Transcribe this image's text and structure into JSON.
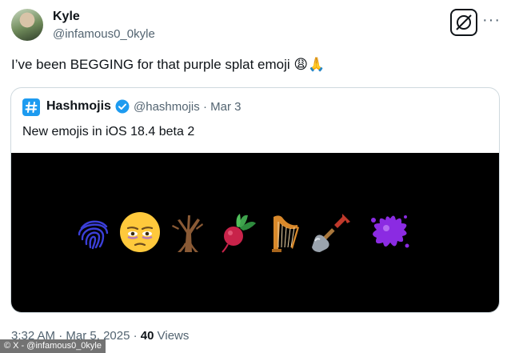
{
  "author": {
    "name": "Kyle",
    "handle": "@infamous0_0kyle"
  },
  "tweet": {
    "text": "I’ve been BEGGING for that purple splat emoji 😩🙏"
  },
  "quoted": {
    "name": "Hashmojis",
    "handle": "@hashmojis",
    "separator": "·",
    "date": "Mar 3",
    "text": "New emojis in iOS 18.4 beta 2",
    "emojis": [
      "fingerprint-icon",
      "face-with-bags-under-eyes-icon",
      "leafless-tree-icon",
      "root-vegetable-icon",
      "harp-icon",
      "shovel-icon",
      "purple-splatter-icon"
    ]
  },
  "meta": {
    "time": "3:32 AM",
    "separator": "·",
    "date": "Mar 5, 2025",
    "separator2": "·",
    "views_count": "40",
    "views_label": "Views"
  },
  "watermark": "© X - @infamous0_0kyle",
  "colors": {
    "accent": "#1d9bf0",
    "text": "#0f1419",
    "muted": "#536471",
    "splat": "#8b2be2"
  }
}
